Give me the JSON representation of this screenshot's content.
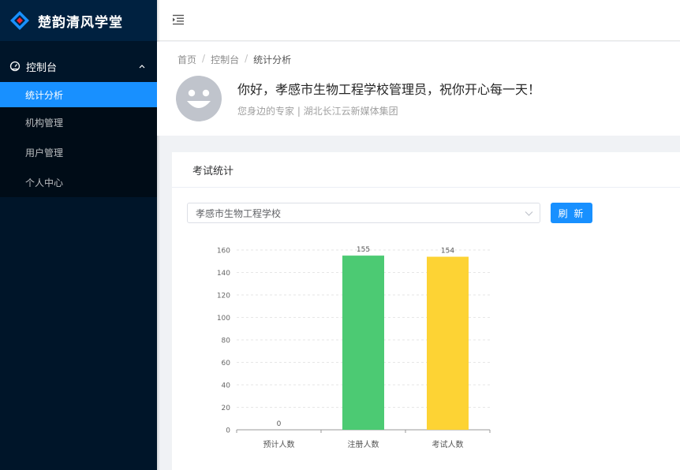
{
  "sidebar": {
    "logo_text": "楚韵清风学堂",
    "group_label": "控制台",
    "items": [
      {
        "label": "统计分析",
        "active": true
      },
      {
        "label": "机构管理",
        "active": false
      },
      {
        "label": "用户管理",
        "active": false
      },
      {
        "label": "个人中心",
        "active": false
      }
    ]
  },
  "breadcrumb": [
    "首页",
    "控制台",
    "统计分析"
  ],
  "greeting": "你好，孝感市生物工程学校管理员，祝你开心每一天！",
  "sub_greeting": "您身边的专家 | 湖北长江云新媒体集团",
  "card": {
    "title": "考试统计",
    "select_value": "孝感市生物工程学校",
    "refresh_label": "刷 新"
  },
  "colors": {
    "accent": "#1890ff",
    "sidebar_bg": "#001529",
    "bar_1": "#5470c6",
    "bar_2": "#4cca73",
    "bar_3": "#fdd334"
  },
  "chart_data": {
    "type": "bar",
    "categories": [
      "预计人数",
      "注册人数",
      "考试人数"
    ],
    "values": [
      0,
      155,
      154
    ],
    "ylim": [
      0,
      160
    ],
    "yticks": [
      0,
      20,
      40,
      60,
      80,
      100,
      120,
      140,
      160
    ],
    "grid": true,
    "data_labels": true
  }
}
